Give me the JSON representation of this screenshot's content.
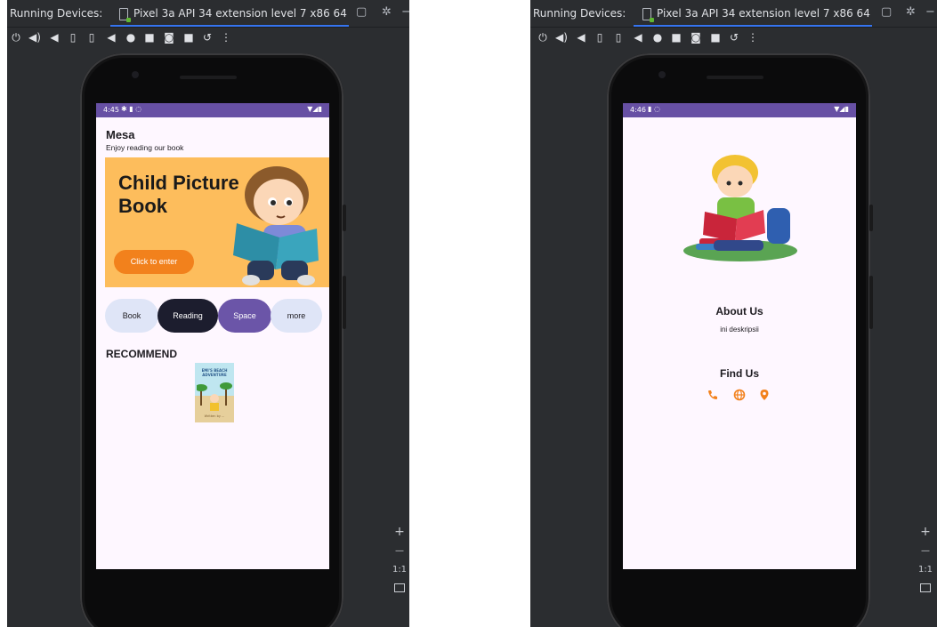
{
  "ide": {
    "running_devices_label": "Running Devices:",
    "device_tab_label": "Pixel 3a API 34 extension level 7 x86 64",
    "toolbar_icons": [
      "power-icon",
      "volume-up-icon",
      "volume-down-icon",
      "rotate-left-icon",
      "rotate-right-icon",
      "back-icon",
      "home-icon",
      "overview-icon",
      "camera-icon",
      "video-icon",
      "snapshot-icon",
      "more-icon"
    ],
    "zoom_controls": {
      "plus": "+",
      "minus": "—",
      "ratio": "1:1"
    },
    "accent_color": "#3574f0"
  },
  "left_screen": {
    "status_time": "4:45",
    "status_bar_color": "#6750a4",
    "app_title": "Mesa",
    "app_subtitle": "Enjoy reading our book",
    "banner": {
      "title": "Child Picture Book",
      "button_label": "Click to enter",
      "background_color": "#fdbd5c",
      "button_color": "#f2811c"
    },
    "categories": [
      {
        "label": "Book",
        "bg": "#dfe5f7",
        "fg": "#1d1b20"
      },
      {
        "label": "Reading",
        "bg": "#1c1d2e",
        "fg": "#ffffff"
      },
      {
        "label": "Space",
        "bg": "#6b55a8",
        "fg": "#ffffff"
      },
      {
        "label": "more",
        "bg": "#dfe5f7",
        "fg": "#1d1b20"
      }
    ],
    "section_heading": "RECOMMEND",
    "recommended_book": {
      "title": "EMI'S BEACH ADVENTURE",
      "author": "Written by ..."
    }
  },
  "right_screen": {
    "status_time": "4:46",
    "about_title": "About Us",
    "about_description": "ini deskripsii",
    "find_title": "Find Us",
    "contact_icons": [
      "phone-icon",
      "globe-icon",
      "location-pin-icon"
    ],
    "contact_color": "#f2811c"
  }
}
